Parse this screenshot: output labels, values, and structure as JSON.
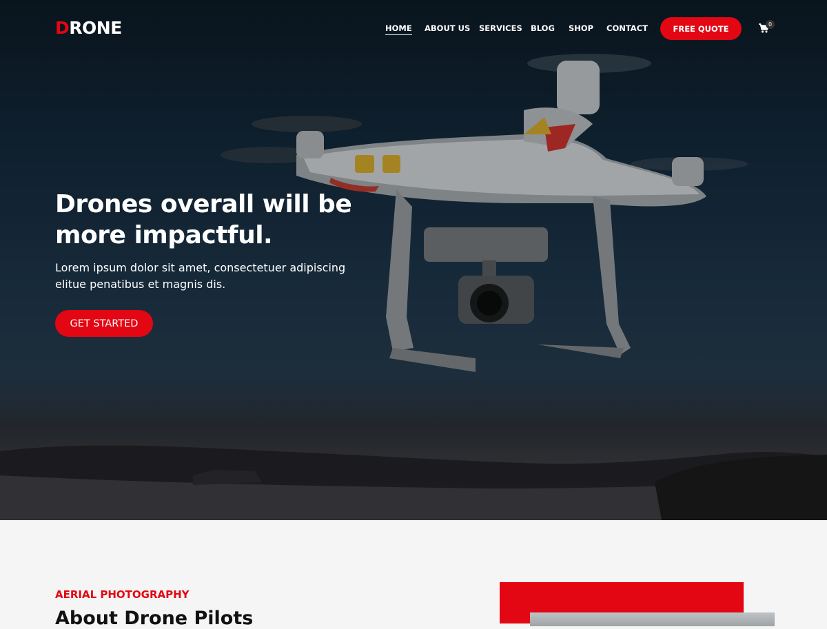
{
  "brand": {
    "first_letter": "D",
    "rest": "RONE",
    "accent": "#e30613"
  },
  "nav": {
    "items": [
      "HOME",
      "ABOUT US",
      "SERVICES",
      "BLOG",
      "SHOP",
      "CONTACT"
    ],
    "active": "HOME",
    "quote_label": "FREE QUOTE",
    "cart_icon": "cart-icon",
    "cart_count": "0"
  },
  "hero": {
    "title": "Drones overall will be more impactful.",
    "subtitle": "Lorem ipsum dolor sit amet, consectetuer adipiscing elitue penatibus et magnis dis.",
    "cta_label": "GET STARTED"
  },
  "about": {
    "eyebrow": "AERIAL PHOTOGRAPHY",
    "title": "About Drone Pilots"
  }
}
